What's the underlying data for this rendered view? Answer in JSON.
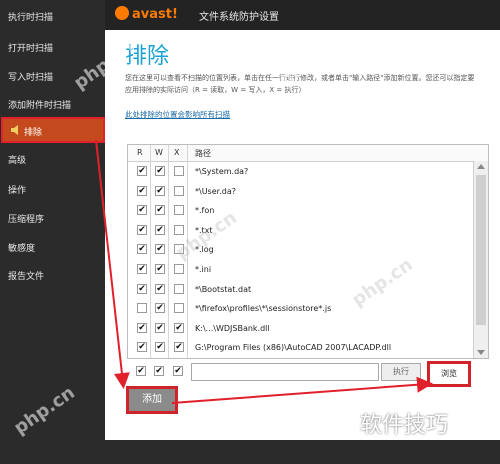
{
  "sidebar": {
    "items": [
      {
        "label": "执行时扫描"
      },
      {
        "label": "打开时扫描"
      },
      {
        "label": "写入时扫描"
      },
      {
        "label": "添加附件时扫描"
      },
      {
        "label": "排除"
      },
      {
        "label": "高级"
      },
      {
        "label": "操作"
      },
      {
        "label": "压缩程序"
      },
      {
        "label": "敏感度"
      },
      {
        "label": "报告文件"
      }
    ]
  },
  "dialog": {
    "logo": "avast!",
    "window_title": "文件系统防护设置",
    "heading": "排除",
    "description": "您在这里可以查看不扫描的位置列表，单击在任一行进行修改，或者单击\"输入路径\"添加新位置。您还可以指定要应用排除的实际访问（R = 读取，W = 写入，X = 执行）",
    "link": "此处排除的位置会影响所有扫描"
  },
  "table": {
    "headers": {
      "r": "R",
      "w": "W",
      "x": "X",
      "path": "路径"
    },
    "rows": [
      {
        "r": true,
        "w": true,
        "x": false,
        "path": "*\\System.da?"
      },
      {
        "r": true,
        "w": true,
        "x": false,
        "path": "*\\User.da?"
      },
      {
        "r": true,
        "w": true,
        "x": false,
        "path": "*.fon"
      },
      {
        "r": true,
        "w": true,
        "x": false,
        "path": "*.txt"
      },
      {
        "r": true,
        "w": true,
        "x": false,
        "path": "*.log"
      },
      {
        "r": true,
        "w": true,
        "x": false,
        "path": "*.ini"
      },
      {
        "r": true,
        "w": true,
        "x": false,
        "path": "*\\Bootstat.dat"
      },
      {
        "r": false,
        "w": true,
        "x": false,
        "path": "*\\firefox\\profiles\\*\\sessionstore*.js"
      },
      {
        "r": true,
        "w": true,
        "x": true,
        "path": "K:\\...\\WDJSBank.dll"
      },
      {
        "r": true,
        "w": true,
        "x": true,
        "path": "G:\\Program Files (x86)\\AutoCAD 2007\\LACADP.dll"
      }
    ]
  },
  "edit": {
    "r": true,
    "w": true,
    "x": true,
    "apply_label": "执行",
    "browse_label": "浏览",
    "add_label": "添加"
  },
  "watermarks": {
    "brand": "软件技巧",
    "site": "php.cn"
  },
  "colors": {
    "accent": "#1aa2d6",
    "highlight": "#d0242a",
    "active": "#c44a1d"
  }
}
